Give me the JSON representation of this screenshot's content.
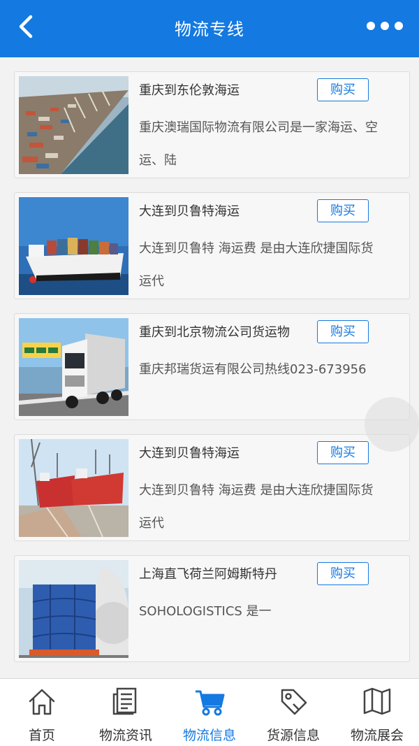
{
  "header": {
    "title": "物流专线"
  },
  "items": [
    {
      "title": "重庆到东伦敦海运",
      "desc": "重庆澳瑞国际物流有限公司是一家海运、空运、陆",
      "buy_label": "购买",
      "image": "port-cranes-photo"
    },
    {
      "title": "大连到贝鲁特海运",
      "desc": "大连到贝鲁特 海运费 是由大连欣捷国际货运代",
      "buy_label": "购买",
      "image": "container-ship-photo"
    },
    {
      "title": "重庆到北京物流公司货运物",
      "desc": "重庆邦瑞货运有限公司热线023-673956",
      "buy_label": "购买",
      "image": "truck-photo"
    },
    {
      "title": "大连到贝鲁特海运",
      "desc": "大连到贝鲁特 海运费 是由大连欣捷国际货运代",
      "buy_label": "购买",
      "image": "red-ships-photo"
    },
    {
      "title": "上海直飞荷兰阿姆斯特丹",
      "desc": "SOHOLOGISTICS 是一",
      "buy_label": "购买",
      "image": "air-cargo-photo"
    }
  ],
  "tabs": [
    {
      "label": "首页",
      "icon": "home-icon"
    },
    {
      "label": "物流资讯",
      "icon": "news-icon"
    },
    {
      "label": "物流信息",
      "icon": "cart-icon",
      "active": true
    },
    {
      "label": "货源信息",
      "icon": "tag-icon"
    },
    {
      "label": "物流展会",
      "icon": "map-icon"
    }
  ],
  "colors": {
    "accent": "#1479e0",
    "background": "#f2f2f2"
  }
}
